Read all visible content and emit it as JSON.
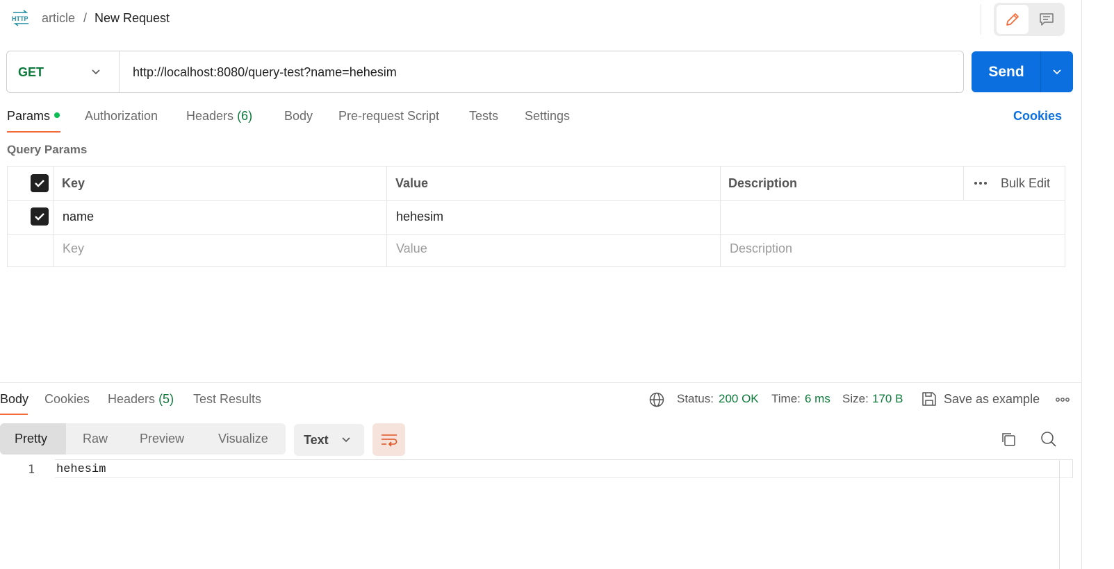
{
  "header": {
    "icon": "http-icon",
    "breadcrumb_parent": "article",
    "breadcrumb_sep": "/",
    "breadcrumb_current": "New Request"
  },
  "request": {
    "method": "GET",
    "url": "http://localhost:8080/query-test?name=hehesim",
    "send_label": "Send"
  },
  "tabs": [
    {
      "label": "Params",
      "active": true
    },
    {
      "label": "Authorization"
    },
    {
      "label": "Headers",
      "count": "(6)"
    },
    {
      "label": "Body"
    },
    {
      "label": "Pre-request Script"
    },
    {
      "label": "Tests"
    },
    {
      "label": "Settings"
    }
  ],
  "cookies_label": "Cookies",
  "query_params": {
    "title": "Query Params",
    "columns": {
      "key": "Key",
      "value": "Value",
      "description": "Description"
    },
    "bulk_edit": "Bulk Edit",
    "rows": [
      {
        "checked": true,
        "key": "name",
        "value": "hehesim",
        "description": ""
      }
    ],
    "placeholders": {
      "key": "Key",
      "value": "Value",
      "description": "Description"
    }
  },
  "response": {
    "tabs": [
      {
        "label": "Body",
        "active": true
      },
      {
        "label": "Cookies"
      },
      {
        "label": "Headers",
        "count": "(5)"
      },
      {
        "label": "Test Results"
      }
    ],
    "status_label": "Status:",
    "status_value": "200 OK",
    "time_label": "Time:",
    "time_value": "6 ms",
    "size_label": "Size:",
    "size_value": "170 B",
    "save_example": "Save as example",
    "formats": [
      "Pretty",
      "Raw",
      "Preview",
      "Visualize"
    ],
    "active_format": "Pretty",
    "language": "Text",
    "lines": [
      {
        "no": "1",
        "text": "hehesim"
      }
    ]
  },
  "colors": {
    "accent": "#0b6fe0",
    "tab_underline": "#f26b3a",
    "success": "#0c7a3a",
    "method_get": "#0c7a3a"
  }
}
